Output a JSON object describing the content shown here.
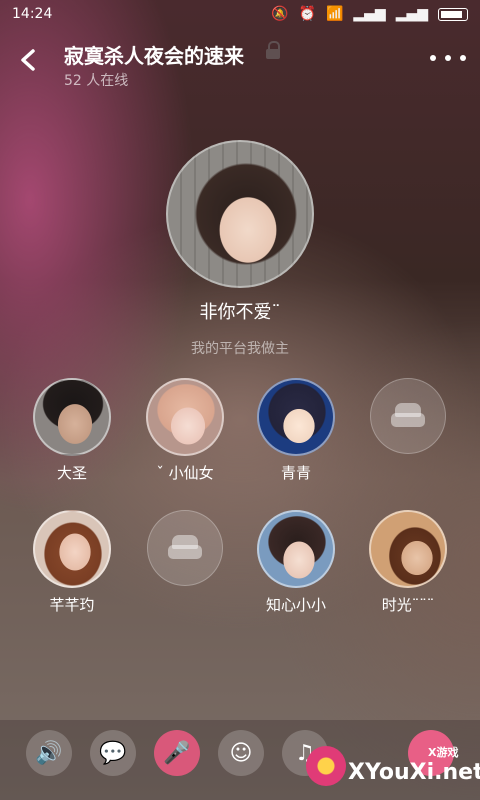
{
  "status_bar": {
    "time": "14:24"
  },
  "header": {
    "title": "寂寞杀人夜会的速来",
    "online": "52 人在线"
  },
  "host": {
    "name": "非你不爱¨",
    "slogan": "我的平台我做主"
  },
  "seats": [
    {
      "name": "大圣"
    },
    {
      "name": "ˇ 小仙女"
    },
    {
      "name": "青青"
    },
    {
      "name": ""
    },
    {
      "name": "芊芊玓"
    },
    {
      "name": ""
    },
    {
      "name": "知心小小"
    },
    {
      "name": "时光¨¨¨"
    }
  ],
  "controls": {
    "speaker_icon": "🔊",
    "chat_icon": "💬",
    "mic_icon": "🎤",
    "emoji_icon": "☺",
    "music_icon": "♫"
  },
  "watermark": {
    "main": "XYouXi.net",
    "small": "X游戏"
  }
}
